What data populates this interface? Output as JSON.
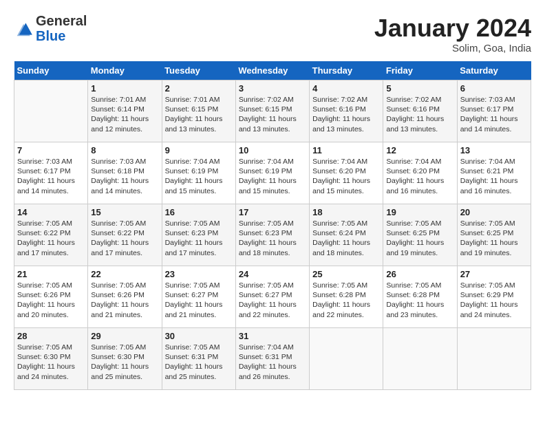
{
  "header": {
    "logo_line1": "General",
    "logo_line2": "Blue",
    "month": "January 2024",
    "location": "Solim, Goa, India"
  },
  "columns": [
    "Sunday",
    "Monday",
    "Tuesday",
    "Wednesday",
    "Thursday",
    "Friday",
    "Saturday"
  ],
  "weeks": [
    [
      {
        "day": "",
        "info": ""
      },
      {
        "day": "1",
        "info": "Sunrise: 7:01 AM\nSunset: 6:14 PM\nDaylight: 11 hours\nand 12 minutes."
      },
      {
        "day": "2",
        "info": "Sunrise: 7:01 AM\nSunset: 6:15 PM\nDaylight: 11 hours\nand 13 minutes."
      },
      {
        "day": "3",
        "info": "Sunrise: 7:02 AM\nSunset: 6:15 PM\nDaylight: 11 hours\nand 13 minutes."
      },
      {
        "day": "4",
        "info": "Sunrise: 7:02 AM\nSunset: 6:16 PM\nDaylight: 11 hours\nand 13 minutes."
      },
      {
        "day": "5",
        "info": "Sunrise: 7:02 AM\nSunset: 6:16 PM\nDaylight: 11 hours\nand 13 minutes."
      },
      {
        "day": "6",
        "info": "Sunrise: 7:03 AM\nSunset: 6:17 PM\nDaylight: 11 hours\nand 14 minutes."
      }
    ],
    [
      {
        "day": "7",
        "info": "Sunrise: 7:03 AM\nSunset: 6:17 PM\nDaylight: 11 hours\nand 14 minutes."
      },
      {
        "day": "8",
        "info": "Sunrise: 7:03 AM\nSunset: 6:18 PM\nDaylight: 11 hours\nand 14 minutes."
      },
      {
        "day": "9",
        "info": "Sunrise: 7:04 AM\nSunset: 6:19 PM\nDaylight: 11 hours\nand 15 minutes."
      },
      {
        "day": "10",
        "info": "Sunrise: 7:04 AM\nSunset: 6:19 PM\nDaylight: 11 hours\nand 15 minutes."
      },
      {
        "day": "11",
        "info": "Sunrise: 7:04 AM\nSunset: 6:20 PM\nDaylight: 11 hours\nand 15 minutes."
      },
      {
        "day": "12",
        "info": "Sunrise: 7:04 AM\nSunset: 6:20 PM\nDaylight: 11 hours\nand 16 minutes."
      },
      {
        "day": "13",
        "info": "Sunrise: 7:04 AM\nSunset: 6:21 PM\nDaylight: 11 hours\nand 16 minutes."
      }
    ],
    [
      {
        "day": "14",
        "info": "Sunrise: 7:05 AM\nSunset: 6:22 PM\nDaylight: 11 hours\nand 17 minutes."
      },
      {
        "day": "15",
        "info": "Sunrise: 7:05 AM\nSunset: 6:22 PM\nDaylight: 11 hours\nand 17 minutes."
      },
      {
        "day": "16",
        "info": "Sunrise: 7:05 AM\nSunset: 6:23 PM\nDaylight: 11 hours\nand 17 minutes."
      },
      {
        "day": "17",
        "info": "Sunrise: 7:05 AM\nSunset: 6:23 PM\nDaylight: 11 hours\nand 18 minutes."
      },
      {
        "day": "18",
        "info": "Sunrise: 7:05 AM\nSunset: 6:24 PM\nDaylight: 11 hours\nand 18 minutes."
      },
      {
        "day": "19",
        "info": "Sunrise: 7:05 AM\nSunset: 6:25 PM\nDaylight: 11 hours\nand 19 minutes."
      },
      {
        "day": "20",
        "info": "Sunrise: 7:05 AM\nSunset: 6:25 PM\nDaylight: 11 hours\nand 19 minutes."
      }
    ],
    [
      {
        "day": "21",
        "info": "Sunrise: 7:05 AM\nSunset: 6:26 PM\nDaylight: 11 hours\nand 20 minutes."
      },
      {
        "day": "22",
        "info": "Sunrise: 7:05 AM\nSunset: 6:26 PM\nDaylight: 11 hours\nand 21 minutes."
      },
      {
        "day": "23",
        "info": "Sunrise: 7:05 AM\nSunset: 6:27 PM\nDaylight: 11 hours\nand 21 minutes."
      },
      {
        "day": "24",
        "info": "Sunrise: 7:05 AM\nSunset: 6:27 PM\nDaylight: 11 hours\nand 22 minutes."
      },
      {
        "day": "25",
        "info": "Sunrise: 7:05 AM\nSunset: 6:28 PM\nDaylight: 11 hours\nand 22 minutes."
      },
      {
        "day": "26",
        "info": "Sunrise: 7:05 AM\nSunset: 6:28 PM\nDaylight: 11 hours\nand 23 minutes."
      },
      {
        "day": "27",
        "info": "Sunrise: 7:05 AM\nSunset: 6:29 PM\nDaylight: 11 hours\nand 24 minutes."
      }
    ],
    [
      {
        "day": "28",
        "info": "Sunrise: 7:05 AM\nSunset: 6:30 PM\nDaylight: 11 hours\nand 24 minutes."
      },
      {
        "day": "29",
        "info": "Sunrise: 7:05 AM\nSunset: 6:30 PM\nDaylight: 11 hours\nand 25 minutes."
      },
      {
        "day": "30",
        "info": "Sunrise: 7:05 AM\nSunset: 6:31 PM\nDaylight: 11 hours\nand 25 minutes."
      },
      {
        "day": "31",
        "info": "Sunrise: 7:04 AM\nSunset: 6:31 PM\nDaylight: 11 hours\nand 26 minutes."
      },
      {
        "day": "",
        "info": ""
      },
      {
        "day": "",
        "info": ""
      },
      {
        "day": "",
        "info": ""
      }
    ]
  ]
}
